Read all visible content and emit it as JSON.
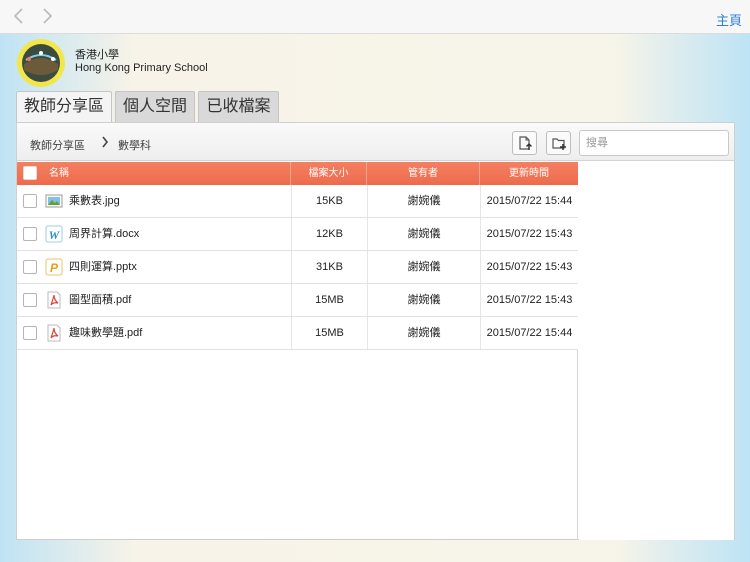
{
  "topbar": {
    "back_icon": "chevron-left-icon",
    "forward_icon": "chevron-right-icon",
    "home_label": "主頁"
  },
  "school": {
    "name_cn": "香港小學",
    "name_en": "Hong Kong Primary School"
  },
  "tabs": [
    {
      "label": "教師分享區",
      "active": true
    },
    {
      "label": "個人空間",
      "active": false
    },
    {
      "label": "已收檔案",
      "active": false
    }
  ],
  "breadcrumb": {
    "root": "教師分享區",
    "current": "數學科"
  },
  "toolbar": {
    "upload_icon": "upload-file-icon",
    "new_folder_icon": "new-folder-icon"
  },
  "search": {
    "placeholder": "搜尋",
    "value": ""
  },
  "table": {
    "headers": {
      "name": "名稱",
      "size": "檔案大小",
      "owner": "管有者",
      "updated": "更新時間"
    },
    "rows": [
      {
        "name": "乘數表.jpg",
        "size": "15KB",
        "owner": "謝婉儀",
        "updated": "2015/07/22 15:44",
        "type": "image"
      },
      {
        "name": "周界計算.docx",
        "size": "12KB",
        "owner": "謝婉儀",
        "updated": "2015/07/22 15:43",
        "type": "word"
      },
      {
        "name": "四則運算.pptx",
        "size": "31KB",
        "owner": "謝婉儀",
        "updated": "2015/07/22 15:43",
        "type": "powerpoint"
      },
      {
        "name": "圖型面積.pdf",
        "size": "15MB",
        "owner": "謝婉儀",
        "updated": "2015/07/22 15:43",
        "type": "pdf"
      },
      {
        "name": "趣味數學題.pdf",
        "size": "15MB",
        "owner": "謝婉儀",
        "updated": "2015/07/22 15:44",
        "type": "pdf"
      }
    ]
  },
  "colors": {
    "accent": "#2f7fd6",
    "header": "#f0704f"
  }
}
